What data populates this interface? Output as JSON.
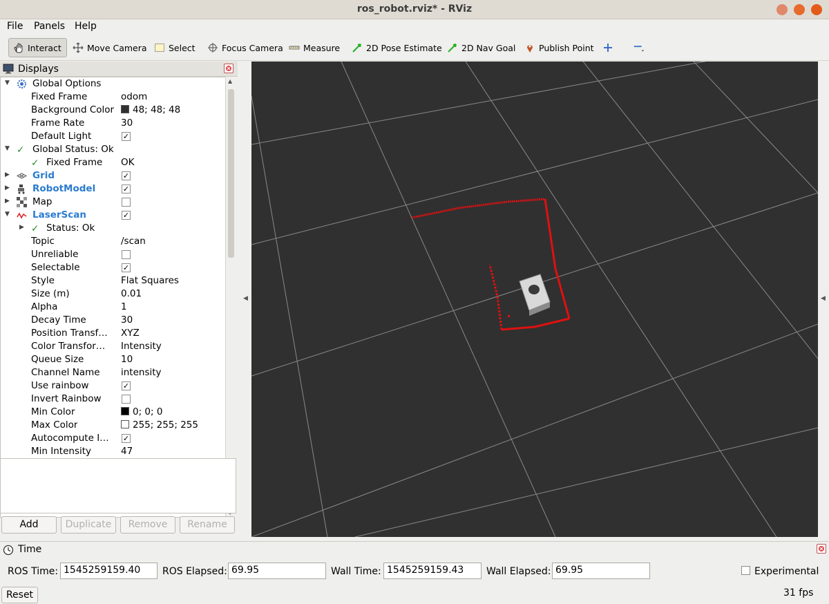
{
  "window": {
    "title": "ros_robot.rviz* - RViz"
  },
  "menu": [
    "File",
    "Panels",
    "Help"
  ],
  "toolbar": {
    "interact": "Interact",
    "move_camera": "Move Camera",
    "select": "Select",
    "focus_camera": "Focus Camera",
    "measure": "Measure",
    "pose_estimate": "2D Pose Estimate",
    "nav_goal": "2D Nav Goal",
    "publish_point": "Publish Point"
  },
  "displays": {
    "title": "Displays",
    "rows": [
      {
        "name": "Global Options",
        "value": ""
      },
      {
        "name": "Fixed Frame",
        "value": "odom"
      },
      {
        "name": "Background Color",
        "value": "48; 48; 48"
      },
      {
        "name": "Frame Rate",
        "value": "30"
      },
      {
        "name": "Default Light",
        "value": ""
      },
      {
        "name": "Global Status: Ok",
        "value": ""
      },
      {
        "name": "Fixed Frame",
        "value": "OK"
      },
      {
        "name": "Grid",
        "value": ""
      },
      {
        "name": "RobotModel",
        "value": ""
      },
      {
        "name": "Map",
        "value": ""
      },
      {
        "name": "LaserScan",
        "value": ""
      },
      {
        "name": "Status: Ok",
        "value": ""
      },
      {
        "name": "Topic",
        "value": "/scan"
      },
      {
        "name": "Unreliable",
        "value": ""
      },
      {
        "name": "Selectable",
        "value": ""
      },
      {
        "name": "Style",
        "value": "Flat Squares"
      },
      {
        "name": "Size (m)",
        "value": "0.01"
      },
      {
        "name": "Alpha",
        "value": "1"
      },
      {
        "name": "Decay Time",
        "value": "30"
      },
      {
        "name": "Position Transf…",
        "value": "XYZ"
      },
      {
        "name": "Color Transfor…",
        "value": "Intensity"
      },
      {
        "name": "Queue Size",
        "value": "10"
      },
      {
        "name": "Channel Name",
        "value": "intensity"
      },
      {
        "name": "Use rainbow",
        "value": ""
      },
      {
        "name": "Invert Rainbow",
        "value": ""
      },
      {
        "name": "Min Color",
        "value": "0; 0; 0"
      },
      {
        "name": "Max Color",
        "value": "255; 255; 255"
      },
      {
        "name": "Autocompute I…",
        "value": ""
      },
      {
        "name": "Min Intensity",
        "value": "47"
      }
    ],
    "buttons": {
      "add": "Add",
      "duplicate": "Duplicate",
      "remove": "Remove",
      "rename": "Rename"
    }
  },
  "time": {
    "title": "Time",
    "ros_time_label": "ROS Time:",
    "ros_time": "1545259159.40",
    "ros_elapsed_label": "ROS Elapsed:",
    "ros_elapsed": "69.95",
    "wall_time_label": "Wall Time:",
    "wall_time": "1545259159.43",
    "wall_elapsed_label": "Wall Elapsed:",
    "wall_elapsed": "69.95",
    "experimental": "Experimental",
    "reset": "Reset",
    "fps": "31 fps"
  },
  "colors": {
    "background": "#303030",
    "laser": "#e01010",
    "grid": "#8a8a8a",
    "accent": "#2a7bd0"
  }
}
